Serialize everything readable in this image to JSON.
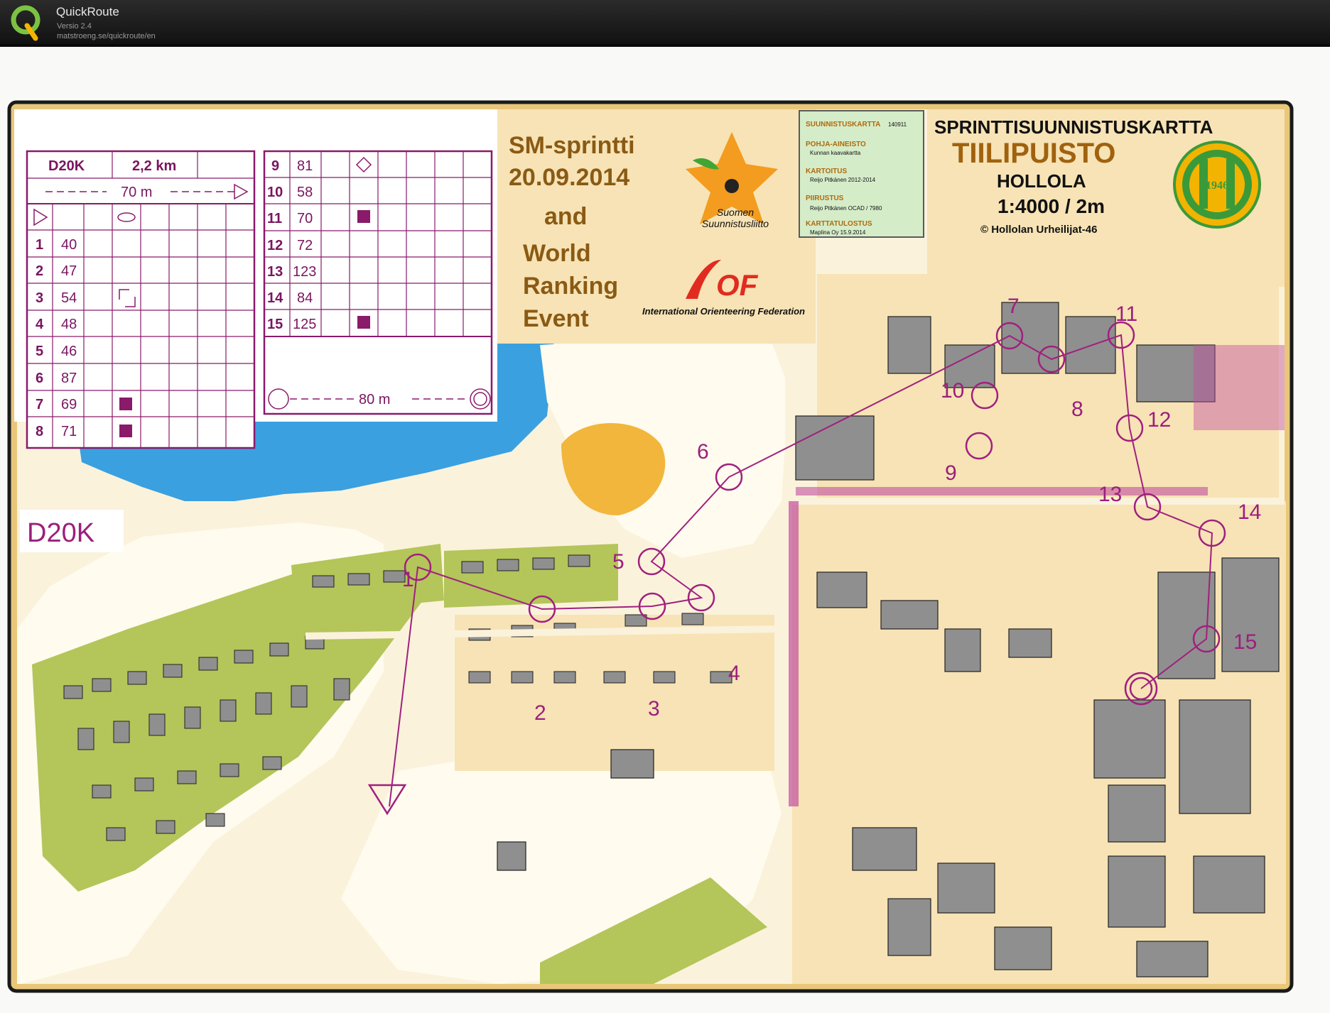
{
  "app": {
    "name": "QuickRoute",
    "version": "Versio 2.4",
    "url": "matstroeng.se/quickroute/en"
  },
  "map_title": {
    "line1": "SPRINTTISUUNNISTUSKARTTA",
    "line2": "TIILIPUISTO",
    "line3": "HOLLOLA",
    "scale": "1:4000 / 2m",
    "club": "© Hollolan Urheilijat-46",
    "club_logo_year": "1946"
  },
  "event": {
    "line1": "SM-sprintti",
    "line2": "20.09.2014",
    "line3": "and",
    "line4": "World",
    "line5": "Ranking",
    "line6": "Event",
    "federation1": "Suomen\nSuunnistusliitto",
    "federation2": "International Orienteering Federation",
    "iof_text": "OF"
  },
  "info_box": {
    "rows": [
      {
        "label": "SUUNNISTUSKARTTA",
        "value": "140911"
      },
      {
        "label": "POHJA-AINEISTO",
        "value": "Kunnan kaavakartta"
      },
      {
        "label": "KARTOITUS",
        "value": "Reijo Pitkänen 2012-2014"
      },
      {
        "label": "PIIRUSTUS",
        "value": "Reijo Pitkänen OCAD / 7980"
      },
      {
        "label": "KARTTATULOSTUS",
        "value": "Maplina Oy 15.9.2014"
      }
    ]
  },
  "course": {
    "class_label": "D20K",
    "class": "D20K",
    "length": "2,2 km",
    "start_to_first": "70 m",
    "finish_distance": "80 m",
    "controls_left": [
      {
        "num": "1",
        "code": "40"
      },
      {
        "num": "2",
        "code": "47"
      },
      {
        "num": "3",
        "code": "54"
      },
      {
        "num": "4",
        "code": "48"
      },
      {
        "num": "5",
        "code": "46"
      },
      {
        "num": "6",
        "code": "87"
      },
      {
        "num": "7",
        "code": "69"
      },
      {
        "num": "8",
        "code": "71"
      }
    ],
    "controls_right": [
      {
        "num": "9",
        "code": "81"
      },
      {
        "num": "10",
        "code": "58"
      },
      {
        "num": "11",
        "code": "70"
      },
      {
        "num": "12",
        "code": "72"
      },
      {
        "num": "13",
        "code": "123"
      },
      {
        "num": "14",
        "code": "84"
      },
      {
        "num": "15",
        "code": "125"
      }
    ]
  },
  "map_control_labels": [
    "1",
    "2",
    "3",
    "4",
    "5",
    "6",
    "7",
    "8",
    "9",
    "10",
    "11",
    "12",
    "13",
    "14",
    "15"
  ],
  "colors": {
    "course": "#a0207e",
    "water": "#3aa0e0",
    "urban": "#f7e3b5",
    "open": "#f2b63c",
    "green": "#a8bf4c",
    "building": "#8f8f8f",
    "titlebar": "#1a1a1a"
  }
}
